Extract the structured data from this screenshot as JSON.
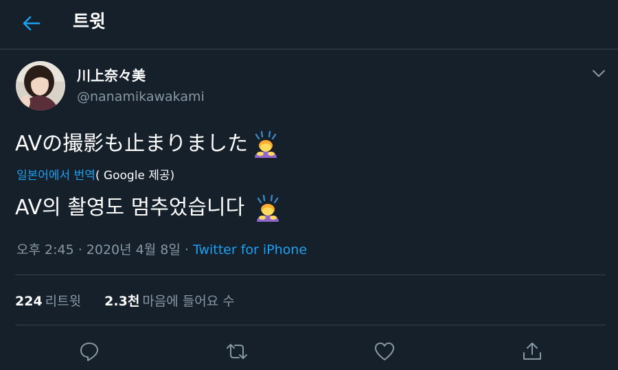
{
  "header": {
    "title": "트윗"
  },
  "tweet": {
    "author": {
      "display_name": "川上奈々美",
      "handle": "@nanamikawakami"
    },
    "text": "AVの撮影も止まりました",
    "translate": {
      "link": "일본어에서 번역",
      "provider": "( Google 제공)"
    },
    "translated_text": "AV의 촬영도 멈추었습니다",
    "meta": {
      "time": "오후 2:45",
      "sep1": " · ",
      "date": "2020년 4월 8일",
      "sep2": " · ",
      "source": "Twitter for iPhone"
    },
    "stats": {
      "retweets": {
        "count": "224",
        "label": "리트윗"
      },
      "likes": {
        "count": "2.3천",
        "label": "마음에 들어요 수"
      }
    }
  },
  "icons": {
    "back": "arrow-left-icon",
    "caret": "chevron-down-icon",
    "reply": "reply-icon",
    "retweet": "retweet-icon",
    "like": "heart-icon",
    "share": "share-icon",
    "emoji": "person-bowing-emoji"
  },
  "colors": {
    "background": "#15202b",
    "accent": "#1da1f2",
    "secondary_text": "#8899a6",
    "border": "#38444d"
  }
}
